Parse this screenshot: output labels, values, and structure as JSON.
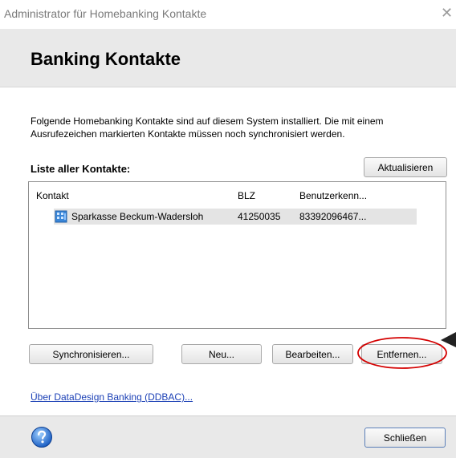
{
  "window": {
    "title": "Administrator für Homebanking Kontakte"
  },
  "header": {
    "title": "Banking Kontakte"
  },
  "intro": {
    "text": "Folgende Homebanking Kontakte sind auf diesem System installiert. Die mit einem Ausrufezeichen markierten Kontakte müssen noch synchronisiert werden."
  },
  "list": {
    "label": "Liste aller Kontakte:",
    "refresh_label": "Aktualisieren",
    "columns": [
      "Kontakt",
      "BLZ",
      "Benutzerkenn..."
    ],
    "rows": [
      {
        "name": "Sparkasse Beckum-Wadersloh",
        "blz": "41250035",
        "user": "83392096467..."
      }
    ]
  },
  "actions": {
    "sync_label": "Synchronisieren...",
    "new_label": "Neu...",
    "edit_label": "Bearbeiten...",
    "remove_label": "Entfernen..."
  },
  "about_link": "Über DataDesign Banking (DDBAC)...",
  "footer": {
    "close_label": "Schließen"
  },
  "icons": {
    "close": "close-icon",
    "bank": "bank-icon",
    "help": "help-icon"
  },
  "colors": {
    "header_bg": "#e9e9e9",
    "selection_bg": "#e4e4e4",
    "link": "#1a3fb5",
    "annotation_red": "#d40000"
  }
}
